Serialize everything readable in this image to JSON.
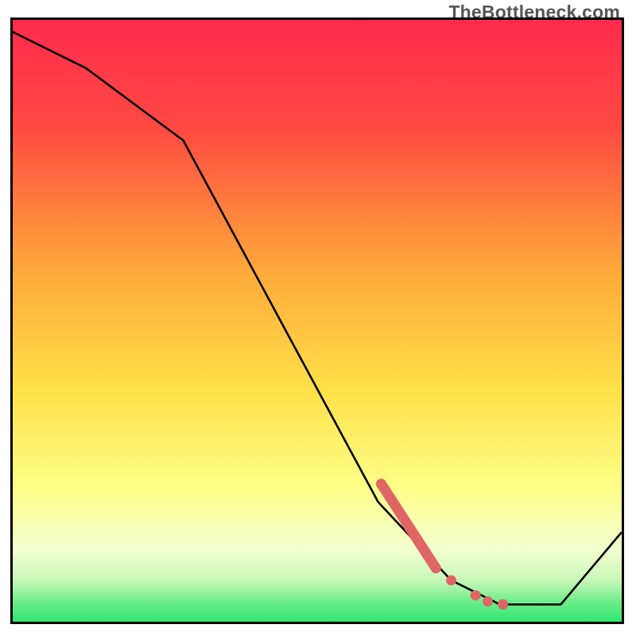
{
  "watermark": "TheBottleneck.com",
  "colors": {
    "border": "#000000",
    "curve": "#000000",
    "marker": "#e06666",
    "grad_top": "#ff2a4d",
    "grad_mid_warm": "#ffe24a",
    "grad_bottom_pale": "#fbffe2",
    "grad_green_light": "#a8f5b4",
    "grad_green": "#2ee86e"
  },
  "chart_data": {
    "type": "line",
    "title": "",
    "xlabel": "",
    "ylabel": "",
    "xlim": [
      0,
      100
    ],
    "ylim": [
      0,
      100
    ],
    "curve": {
      "x": [
        0,
        12,
        28,
        60,
        72,
        80,
        90,
        100
      ],
      "y": [
        98,
        92,
        80,
        20,
        7,
        3,
        3,
        15
      ]
    },
    "markers_thick": [
      {
        "x1": 60.5,
        "y1": 23.0,
        "x2": 69.5,
        "y2": 9.0
      }
    ],
    "markers_dots": [
      {
        "x": 72.0,
        "y": 7.0
      },
      {
        "x": 76.0,
        "y": 4.5
      },
      {
        "x": 78.0,
        "y": 3.5
      },
      {
        "x": 80.5,
        "y": 3.0
      }
    ],
    "gradient_stops": [
      {
        "offset": 0.0,
        "color": "#ff2a4d"
      },
      {
        "offset": 0.18,
        "color": "#ff4a42"
      },
      {
        "offset": 0.42,
        "color": "#ffaa3a"
      },
      {
        "offset": 0.62,
        "color": "#ffe24a"
      },
      {
        "offset": 0.78,
        "color": "#feff8a"
      },
      {
        "offset": 0.88,
        "color": "#f2ffd0"
      },
      {
        "offset": 0.93,
        "color": "#c8f7b8"
      },
      {
        "offset": 0.965,
        "color": "#6eed8c"
      },
      {
        "offset": 1.0,
        "color": "#2ee86e"
      }
    ]
  }
}
